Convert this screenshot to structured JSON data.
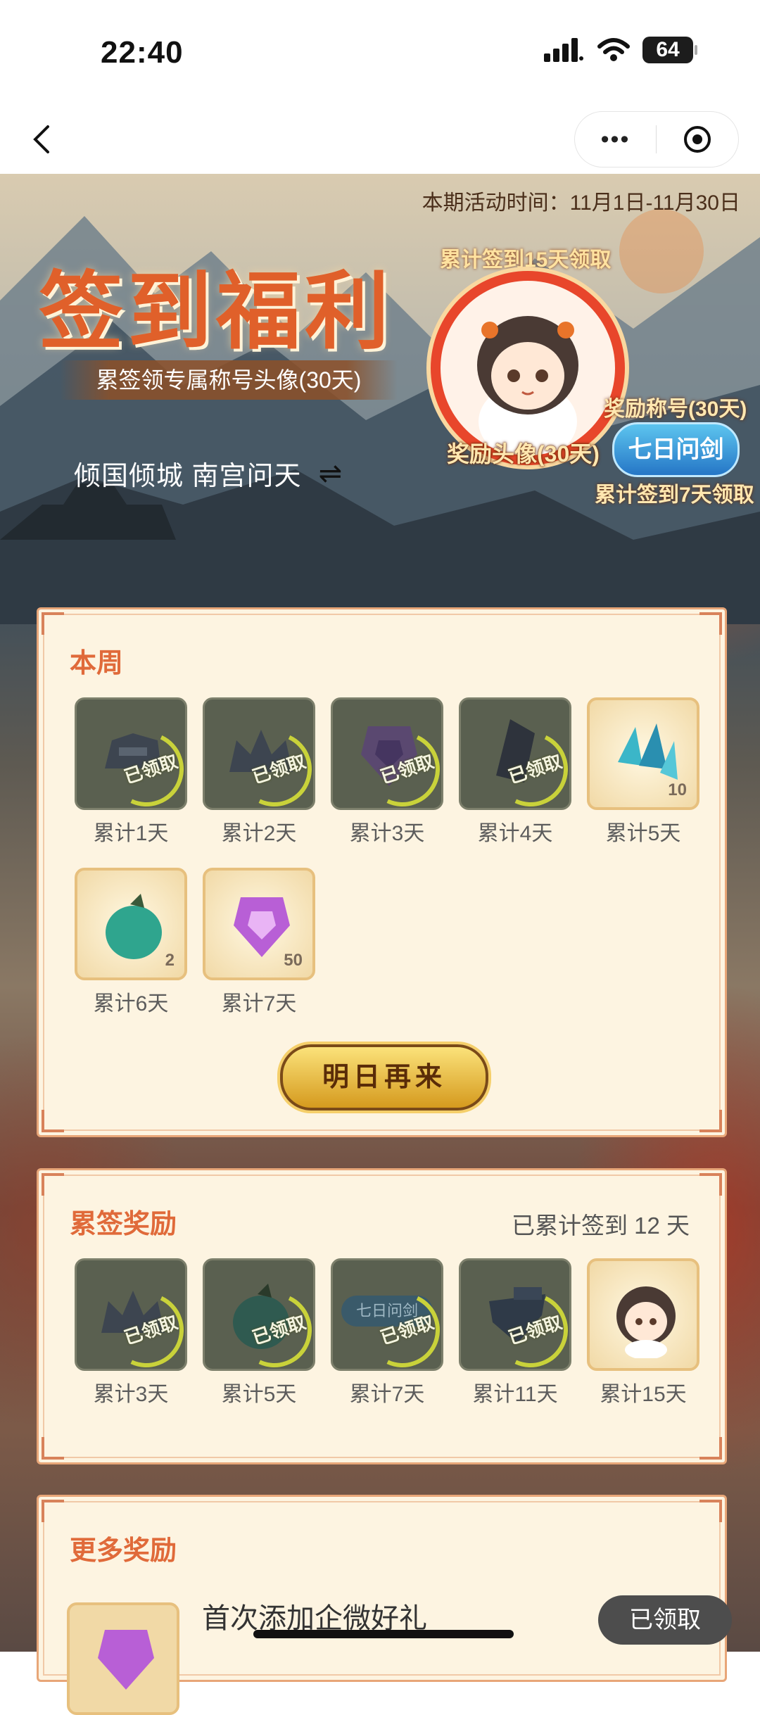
{
  "status_bar": {
    "time": "22:40",
    "battery": "64"
  },
  "hero": {
    "period": "本期活动时间：11月1日-11月30日",
    "title": "签到福利",
    "subtitle": "累签领专属称号头像(30天)",
    "user_titles": "倾国倾城 南宫问天",
    "cum15_note": "累计签到15天领取",
    "reward_avatar": "奖励头像(30天)",
    "reward_title": "奖励称号(30天)",
    "title_badge": "七日问剑",
    "cum7_note": "累计签到7天领取"
  },
  "weekly": {
    "title": "本周",
    "items": [
      {
        "label": "累计1天",
        "claimed": "已领取",
        "icon": "helmet-icon"
      },
      {
        "label": "累计2天",
        "claimed": "已领取",
        "icon": "crown-icon"
      },
      {
        "label": "累计3天",
        "claimed": "已领取",
        "icon": "gem-token-icon"
      },
      {
        "label": "累计4天",
        "claimed": "已领取",
        "icon": "crystal-icon"
      },
      {
        "label": "累计5天",
        "count": "10",
        "icon": "blue-crystal-icon"
      },
      {
        "label": "累计6天",
        "count": "2",
        "icon": "green-pouch-icon"
      },
      {
        "label": "累计7天",
        "count": "50",
        "icon": "purple-token-icon"
      }
    ],
    "button": "明日再来"
  },
  "cumulative": {
    "title": "累签奖励",
    "summary": "已累计签到 12 天",
    "items": [
      {
        "label": "累计3天",
        "claimed": "已领取",
        "icon": "crown-icon"
      },
      {
        "label": "累计5天",
        "claimed": "已领取",
        "icon": "green-pouch-icon"
      },
      {
        "label": "累计7天",
        "claimed": "已领取",
        "icon": "title-badge-icon",
        "badge_text": "七日问剑"
      },
      {
        "label": "累计11天",
        "claimed": "已领取",
        "icon": "armor-icon"
      },
      {
        "label": "累计15天",
        "icon": "avatar-icon"
      }
    ]
  },
  "more": {
    "title": "更多奖励",
    "item_text": "首次添加企微好礼",
    "button": "已领取"
  },
  "colors": {
    "accent": "#e06a3a",
    "panel_bg": "#fdf4e1",
    "claimed_ring": "#c9d23a",
    "badge_blue": "#2576c6"
  }
}
